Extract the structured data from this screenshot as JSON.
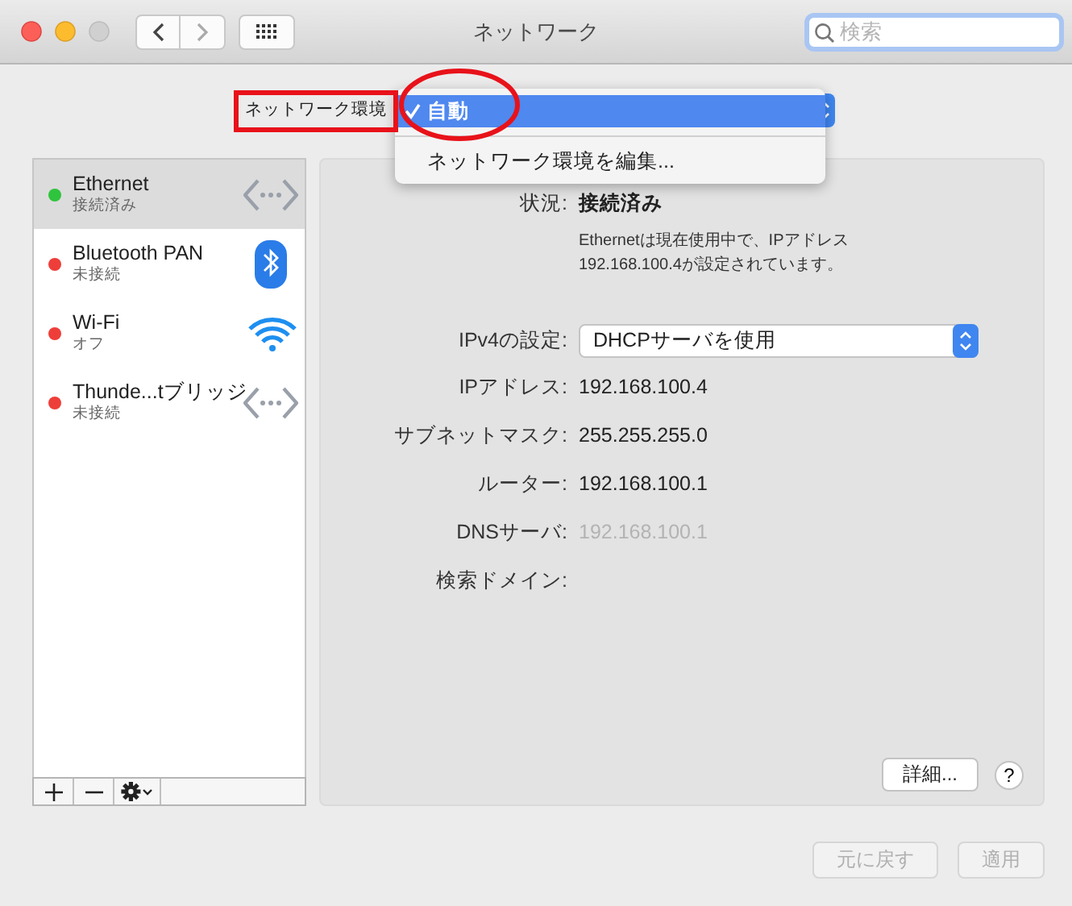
{
  "window": {
    "title": "ネットワーク",
    "search": {
      "placeholder": "検索"
    }
  },
  "location": {
    "label": "ネットワーク環境",
    "menu": [
      {
        "label": "自動",
        "selected": true
      },
      {
        "label": "ネットワーク環境を編集...",
        "selected": false
      }
    ]
  },
  "annotations": [
    {
      "kind": "box"
    },
    {
      "kind": "ellipse"
    }
  ],
  "services": [
    {
      "name": "Ethernet",
      "status": "接続済み",
      "color": "#2fc43d",
      "kind": "ethernet",
      "selected": true
    },
    {
      "name": "Bluetooth PAN",
      "status": "未接続",
      "color": "#ee3e3a",
      "kind": "bluetooth",
      "selected": false
    },
    {
      "name": "Wi-Fi",
      "status": "オフ",
      "color": "#ee3e3a",
      "kind": "wifi",
      "selected": false
    },
    {
      "name": "Thunde...tブリッジ",
      "status": "未接続",
      "color": "#ee3e3a",
      "kind": "ethernet",
      "selected": false
    }
  ],
  "details": {
    "status_label": "状況:",
    "status": "接続済み",
    "description": "Ethernetは現在使用中で、IPアドレス\n192.168.100.4が設定されています。",
    "fields": [
      {
        "label": "IPv4の設定:",
        "value": "DHCPサーバを使用",
        "kind": "popup"
      },
      {
        "label": "IPアドレス:",
        "value": "192.168.100.4",
        "kind": "text"
      },
      {
        "label": "サブネットマスク:",
        "value": "255.255.255.0",
        "kind": "text"
      },
      {
        "label": "ルーター:",
        "value": "192.168.100.1",
        "kind": "text"
      },
      {
        "label": "DNSサーバ:",
        "value": "192.168.100.1",
        "kind": "readonly"
      },
      {
        "label": "検索ドメイン:",
        "kind": "text"
      }
    ],
    "advanced_button": "詳細...",
    "help_button": "?"
  },
  "footer_buttons": [
    {
      "label": "元に戻す",
      "disabled": true
    },
    {
      "label": "適用",
      "disabled": true
    }
  ]
}
